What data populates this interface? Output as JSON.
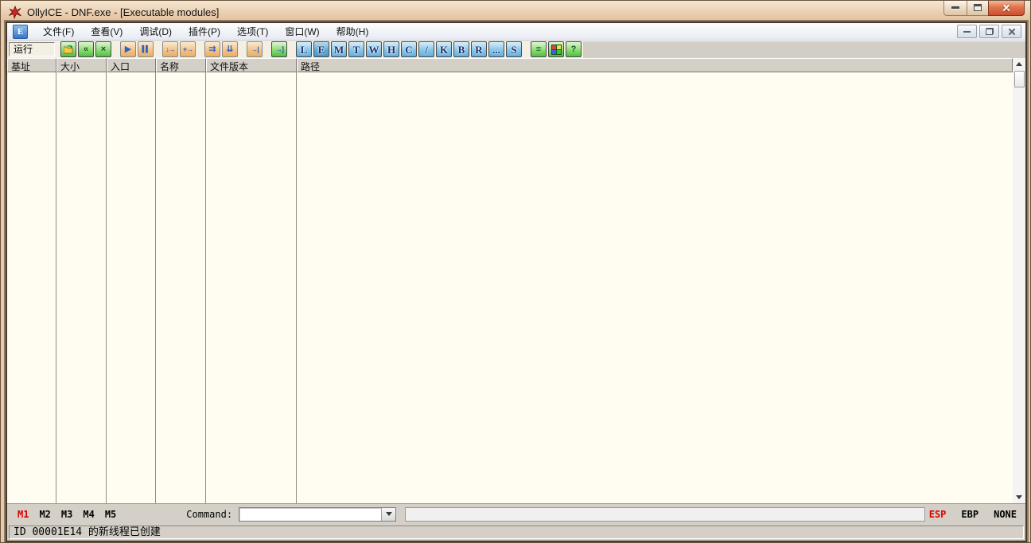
{
  "window": {
    "title": "OllyICE - DNF.exe - [Executable modules]",
    "app_icon": "red-splat-icon"
  },
  "colors": {
    "titlebar_tan": "#E7C9AC",
    "table_background": "#FFFCF1",
    "chrome_grey": "#D4D0C8",
    "toolbar_band": "#F3EFE2",
    "active_red": "#E00000",
    "letter_button_blue": "#87C5EA",
    "green_button": "#8CDB78",
    "tan_button": "#F3C489"
  },
  "menu": {
    "child_icon_letter": "E",
    "items": [
      "文件(F)",
      "查看(V)",
      "调试(D)",
      "插件(P)",
      "选项(T)",
      "窗口(W)",
      "帮助(H)"
    ]
  },
  "toolbar": {
    "status_text": "运行",
    "icons": {
      "open": "open-folder-icon",
      "restart": "«",
      "close": "×",
      "run": "▶",
      "pause": "▌▌",
      "step_into": "↓→",
      "step_over": "+→",
      "animate_into": "⇉",
      "animate_over": "⇊",
      "till_return": "→|",
      "go_to": "→]",
      "log": "≡",
      "appearance": "color-grid-icon",
      "help": "?"
    },
    "window_letters": [
      "L",
      "E",
      "M",
      "T",
      "W",
      "H",
      "C",
      "/",
      "K",
      "B",
      "R",
      "...",
      "S"
    ],
    "active_window_letter": "E"
  },
  "table": {
    "columns": [
      "基址",
      "大小",
      "入口",
      "名称",
      "文件版本",
      "路径"
    ],
    "rows": []
  },
  "bottom_bar": {
    "memory_buttons": [
      "M1",
      "M2",
      "M3",
      "M4",
      "M5"
    ],
    "active_memory_button": "M1",
    "command_label": "Command:",
    "command_value": "",
    "flags": [
      "ESP",
      "EBP",
      "NONE"
    ],
    "active_flag": "ESP"
  },
  "status_bar": {
    "message": "ID 00001E14 的新线程已创建"
  }
}
